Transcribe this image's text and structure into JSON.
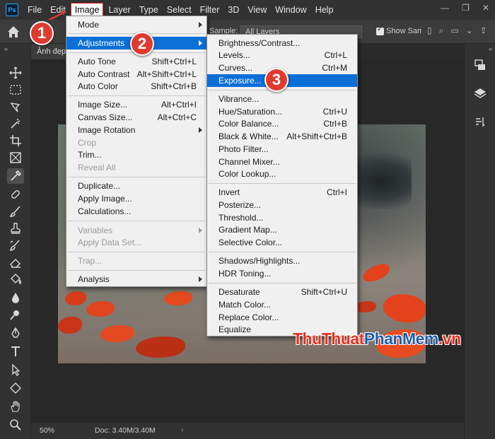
{
  "app": {
    "logo": "Ps"
  },
  "menubar": {
    "items": [
      "File",
      "Edit",
      "Image",
      "Layer",
      "Type",
      "Select",
      "Filter",
      "3D",
      "View",
      "Window",
      "Help"
    ]
  },
  "options": {
    "sample_label": "Sample:",
    "sample_value": "All Layers",
    "show_sampling": "Show Samp"
  },
  "document": {
    "tab_title": "Ảnh đẹp",
    "zoom": "50%",
    "doc_info": "Doc: 3.40M/3.40M"
  },
  "image_menu": {
    "mode": "Mode",
    "adjustments": "Adjustments",
    "auto_tone": "Auto Tone",
    "auto_tone_sc": "Shift+Ctrl+L",
    "auto_contrast": "Auto Contrast",
    "auto_contrast_sc": "Alt+Shift+Ctrl+L",
    "auto_color": "Auto Color",
    "auto_color_sc": "Shift+Ctrl+B",
    "image_size": "Image Size...",
    "image_size_sc": "Alt+Ctrl+I",
    "canvas_size": "Canvas Size...",
    "canvas_size_sc": "Alt+Ctrl+C",
    "image_rotation": "Image Rotation",
    "crop": "Crop",
    "trim": "Trim...",
    "reveal_all": "Reveal All",
    "duplicate": "Duplicate...",
    "apply_image": "Apply Image...",
    "calculations": "Calculations...",
    "variables": "Variables",
    "apply_data_set": "Apply Data Set...",
    "trap": "Trap...",
    "analysis": "Analysis"
  },
  "adjustments_menu": {
    "brightness": "Brightness/Contrast...",
    "levels": "Levels...",
    "levels_sc": "Ctrl+L",
    "curves": "Curves...",
    "curves_sc": "Ctrl+M",
    "exposure": "Exposure...",
    "vibrance": "Vibrance...",
    "hue_sat": "Hue/Saturation...",
    "hue_sat_sc": "Ctrl+U",
    "color_balance": "Color Balance...",
    "color_balance_sc": "Ctrl+B",
    "black_white": "Black & White...",
    "black_white_sc": "Alt+Shift+Ctrl+B",
    "photo_filter": "Photo Filter...",
    "channel_mixer": "Channel Mixer...",
    "color_lookup": "Color Lookup...",
    "invert": "Invert",
    "invert_sc": "Ctrl+I",
    "posterize": "Posterize...",
    "threshold": "Threshold...",
    "gradient_map": "Gradient Map...",
    "selective_color": "Selective Color...",
    "shadows_highlights": "Shadows/Highlights...",
    "hdr_toning": "HDR Toning...",
    "desaturate": "Desaturate",
    "desaturate_sc": "Shift+Ctrl+U",
    "match_color": "Match Color...",
    "replace_color": "Replace Color...",
    "equalize": "Equalize"
  },
  "steps": [
    "1",
    "2",
    "3"
  ],
  "watermark": {
    "part1": "ThuThuat",
    "part2": "PhanMem",
    "part3": ".vn"
  },
  "colors": {
    "highlight": "#0b6fd7",
    "badge": "#e03a2e",
    "menu_bg": "#f0f0f0",
    "app_bg": "#2b2b2b"
  }
}
